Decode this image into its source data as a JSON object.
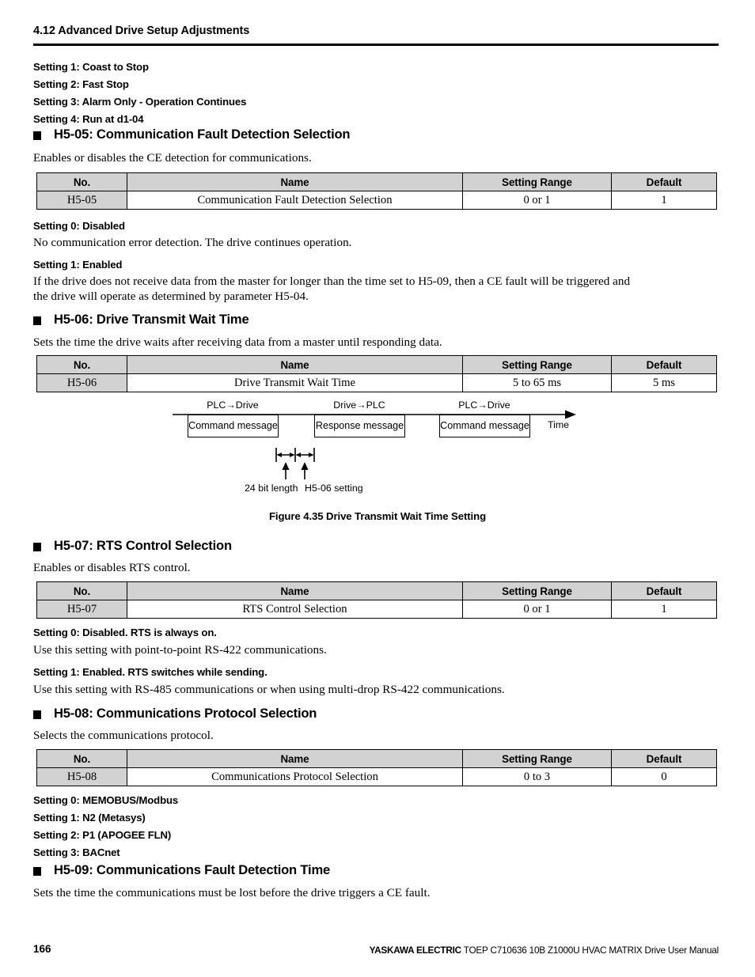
{
  "header": {
    "running_head": "4.12 Advanced Drive Setup Adjustments"
  },
  "top_settings": [
    "Setting 1: Coast to Stop",
    "Setting 2: Fast Stop",
    "Setting 3: Alarm Only - Operation Continues",
    "Setting 4: Run at d1-04"
  ],
  "table_columns": {
    "no": "No.",
    "name": "Name",
    "setting_range": "Setting Range",
    "default": "Default"
  },
  "sections": {
    "h5_05": {
      "heading": "H5-05: Communication Fault Detection Selection",
      "intro": "Enables or disables the CE detection for communications.",
      "table_row": {
        "no": "H5-05",
        "name": "Communication Fault Detection Selection",
        "setting_range": "0 or 1",
        "default": "1"
      },
      "setting0_head": "Setting 0: Disabled",
      "setting0_body": "No communication error detection. The drive continues operation.",
      "setting1_head": "Setting 1: Enabled",
      "setting1_body_line1": "If the drive does not receive data from the master for longer than the time set to H5-09, then a CE fault will be triggered and",
      "setting1_body_line2": "the drive will operate as determined by parameter H5-04."
    },
    "h5_06": {
      "heading": "H5-06: Drive Transmit Wait Time",
      "intro": "Sets the time the drive waits after receiving data from a master until responding data.",
      "table_row": {
        "no": "H5-06",
        "name": "Drive Transmit Wait Time",
        "setting_range": "5 to 65 ms",
        "default": "5 ms"
      }
    },
    "h5_07": {
      "heading": "H5-07: RTS Control Selection",
      "intro": "Enables or disables RTS control.",
      "table_row": {
        "no": "H5-07",
        "name": "RTS Control Selection",
        "setting_range": "0 or 1",
        "default": "1"
      },
      "setting0_head": "Setting 0: Disabled. RTS is always on.",
      "setting0_body": "Use this setting with point-to-point RS-422 communications.",
      "setting1_head": "Setting 1: Enabled. RTS switches while sending.",
      "setting1_body": "Use this setting with RS-485 communications or when using multi-drop RS-422 communications."
    },
    "h5_08": {
      "heading": "H5-08: Communications Protocol Selection",
      "intro": "Selects the communications protocol.",
      "table_row": {
        "no": "H5-08",
        "name": "Communications Protocol Selection",
        "setting_range": "0 to 3",
        "default": "0"
      },
      "settings": [
        "Setting 0: MEMOBUS/Modbus",
        "Setting 1: N2 (Metasys)",
        "Setting 2: P1 (APOGEE FLN)",
        "Setting 3: BACnet"
      ]
    },
    "h5_09": {
      "heading": "H5-09: Communications Fault Detection Time",
      "intro": "Sets the time the communications must be lost before the drive triggers a CE fault."
    }
  },
  "figure": {
    "caption": "Figure 4.35  Drive Transmit Wait Time Setting",
    "direction_labels": [
      "PLC→Drive",
      "Drive→PLC",
      "PLC→Drive"
    ],
    "message_boxes": [
      "Command message",
      "Response message",
      "Command message"
    ],
    "axis_label": "Time",
    "dimension_labels": [
      "24 bit length",
      "H5-06 setting"
    ]
  },
  "footer": {
    "page_number": "166",
    "brand": "YASKAWA ELECTRIC",
    "manual": " TOEP C710636 10B Z1000U HVAC MATRIX Drive User Manual"
  }
}
